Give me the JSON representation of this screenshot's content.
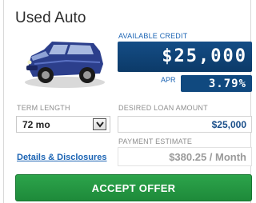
{
  "offer": {
    "title": "Used Auto",
    "available_credit_label": "AVAILABLE CREDIT",
    "available_credit_value": "$25,000",
    "apr_label": "APR",
    "apr_value": "3.79%"
  },
  "form": {
    "term_label": "TERM LENGTH",
    "term_value": "72 mo",
    "desired_label": "DESIRED LOAN AMOUNT",
    "desired_value": "$25,000",
    "payment_label": "PAYMENT ESTIMATE",
    "payment_value": "$380.25 / Month",
    "details_link": "Details & Disclosures"
  },
  "actions": {
    "accept_label": "ACCEPT OFFER"
  },
  "icons": {
    "vehicle": "car-icon",
    "dropdown": "chevron-down-icon"
  },
  "colors": {
    "credit_box": "#0c3a68",
    "link": "#1a63b3",
    "accept": "#1e8a3a"
  }
}
